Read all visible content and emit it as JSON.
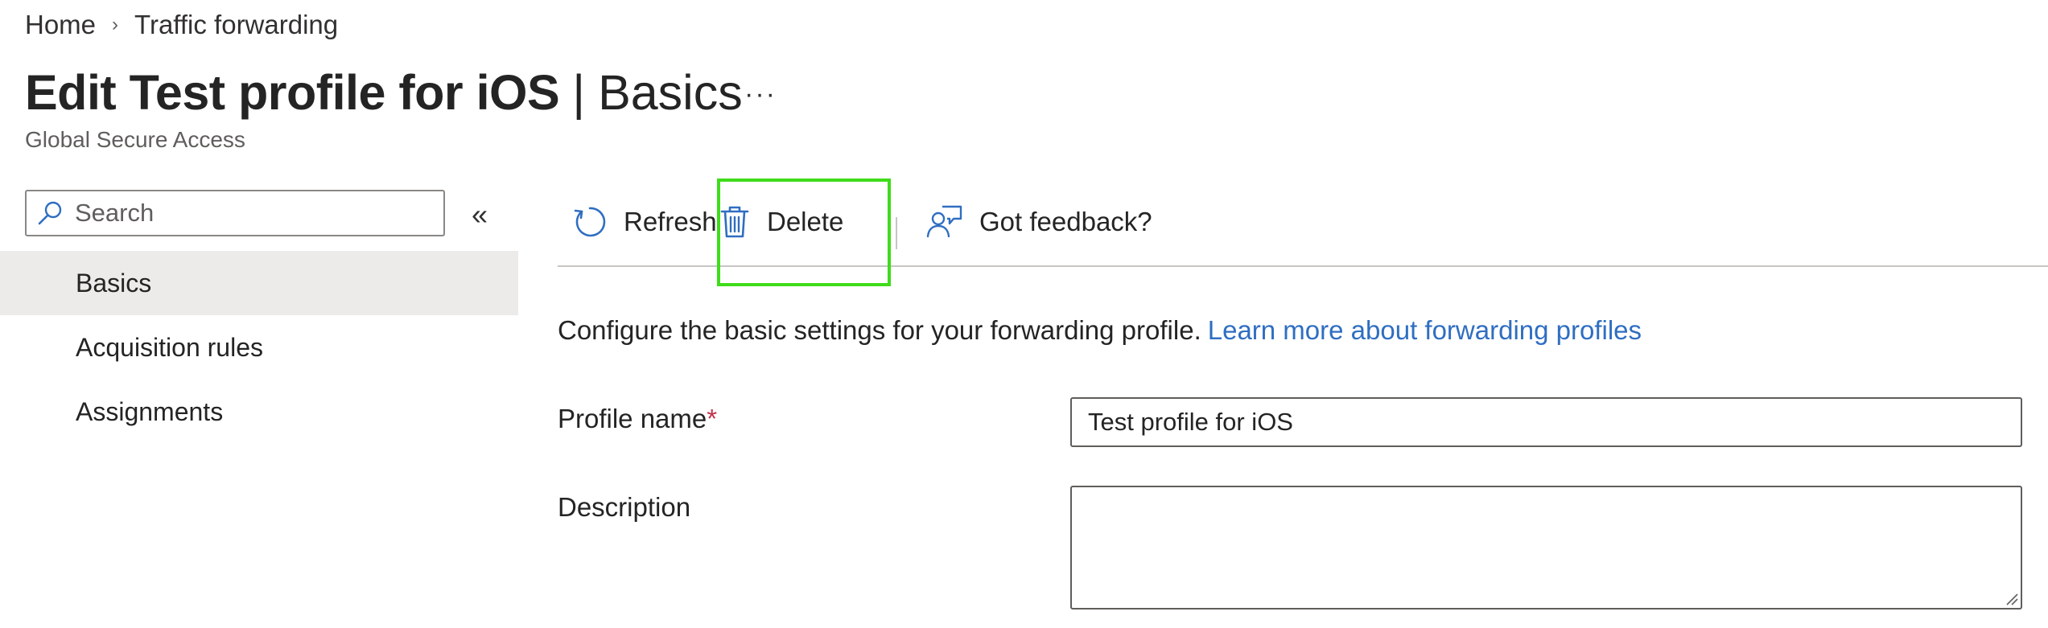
{
  "breadcrumb": {
    "home": "Home",
    "separator": "›",
    "current": "Traffic forwarding"
  },
  "header": {
    "title_bold": "Edit Test profile for iOS",
    "title_separator": "|",
    "title_section": "Basics",
    "more": "···",
    "subtitle": "Global Secure Access"
  },
  "sidebar": {
    "search_placeholder": "Search",
    "collapse": "«",
    "items": [
      {
        "label": "Basics",
        "active": true
      },
      {
        "label": "Acquisition rules",
        "active": false
      },
      {
        "label": "Assignments",
        "active": false
      }
    ]
  },
  "toolbar": {
    "refresh_label": "Refresh",
    "delete_label": "Delete",
    "feedback_label": "Got feedback?"
  },
  "content": {
    "description": "Configure the basic settings for your forwarding profile.",
    "learn_more": "Learn more about forwarding profiles",
    "profile_name_label": "Profile name",
    "required_mark": "*",
    "profile_name_value": "Test profile for iOS",
    "description_label": "Description",
    "description_value": ""
  },
  "colors": {
    "accent": "#2f6ec1",
    "highlight": "#3fdc1a",
    "required": "#c4314b",
    "nav_active_bg": "#edebe9"
  },
  "icons": {
    "search": "search-icon",
    "refresh": "refresh-icon",
    "delete": "trash-icon",
    "feedback": "feedback-icon"
  }
}
